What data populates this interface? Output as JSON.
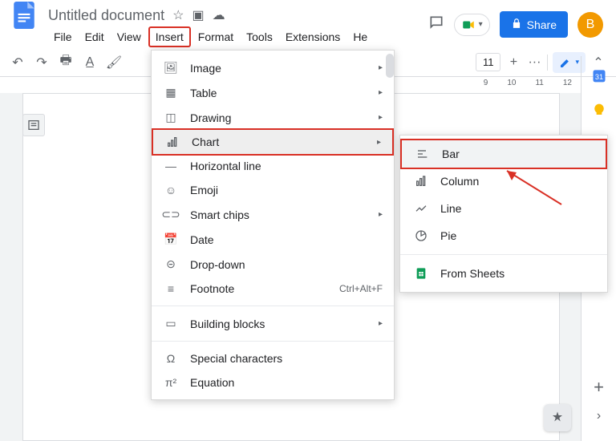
{
  "doc": {
    "title": "Untitled document"
  },
  "menubar": {
    "file": "File",
    "edit": "Edit",
    "view": "View",
    "insert": "Insert",
    "format": "Format",
    "tools": "Tools",
    "extensions": "Extensions",
    "help": "He"
  },
  "header": {
    "share_label": "Share",
    "avatar_letter": "B"
  },
  "toolbar_right": {
    "zoom_box_text": "11",
    "plus": "+",
    "more": "···"
  },
  "insert_menu": {
    "image": "Image",
    "table": "Table",
    "drawing": "Drawing",
    "chart": "Chart",
    "horizontal_line": "Horizontal line",
    "emoji": "Emoji",
    "smart_chips": "Smart chips",
    "date": "Date",
    "dropdown": "Drop-down",
    "footnote": "Footnote",
    "footnote_shortcut": "Ctrl+Alt+F",
    "building_blocks": "Building blocks",
    "special_chars": "Special characters",
    "equation": "Equation"
  },
  "chart_submenu": {
    "bar": "Bar",
    "column": "Column",
    "line": "Line",
    "pie": "Pie",
    "from_sheets": "From Sheets"
  },
  "ruler_visible_marks": [
    "9",
    "10",
    "11",
    "12"
  ]
}
